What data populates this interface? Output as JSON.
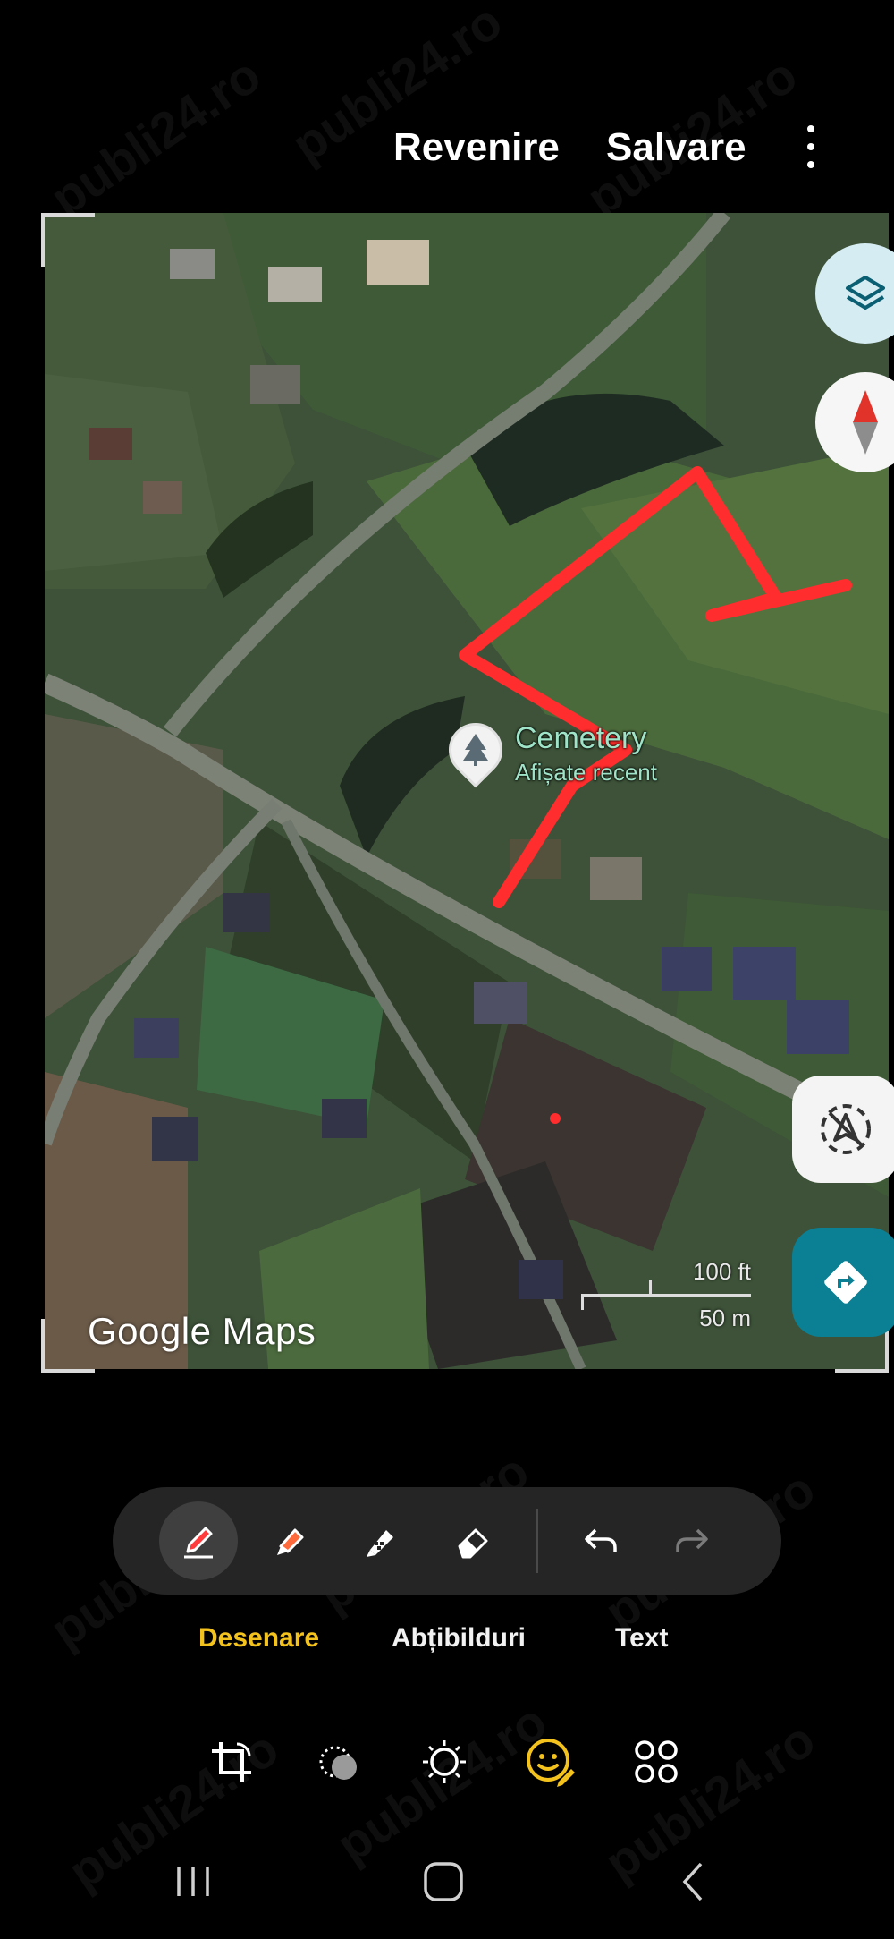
{
  "topbar": {
    "revert_label": "Revenire",
    "save_label": "Salvare"
  },
  "map": {
    "logo": "Google Maps",
    "poi": {
      "title": "Cemetery",
      "subtitle": "Afișate recent"
    },
    "scale": {
      "imperial": "100 ft",
      "metric": "50 m"
    },
    "annotation_color": "#ff2d2d"
  },
  "pen_tools": [
    "pen-icon",
    "highlighter-icon",
    "pencil-icon",
    "eraser-icon",
    "undo-icon",
    "redo-icon"
  ],
  "mode_tabs": {
    "draw": "Desenare",
    "stickers": "Abțibilduri",
    "text": "Text"
  },
  "edit_tools": [
    "crop-icon",
    "filter-icon",
    "brightness-icon",
    "decoration-icon",
    "more-tools-icon"
  ],
  "watermark": "publi24.ro",
  "colors": {
    "accent": "#f3c21d",
    "background": "#000000",
    "directions": "#0b7f93"
  }
}
